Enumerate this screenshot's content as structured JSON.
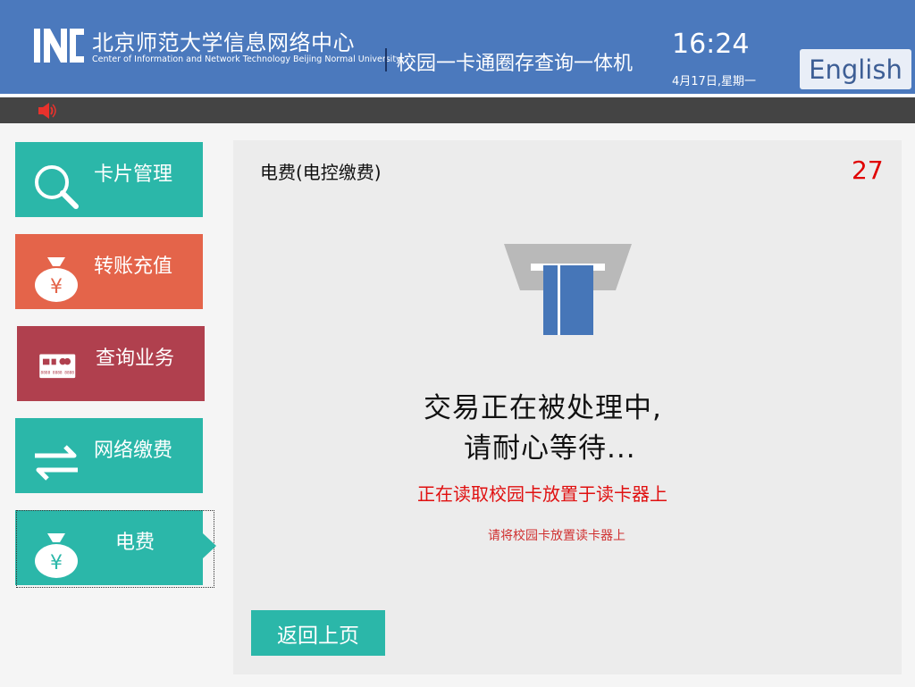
{
  "header": {
    "logo_text": "INC",
    "org_name_cn": "北京师范大学信息网络中心",
    "org_name_en": "Center of Information and Network Technology Beijing Normal University",
    "app_title": "校园一卡通圈存查询一体机",
    "time": "16:24",
    "date": "4月17日,星期一",
    "language_button": "English"
  },
  "sidebar": {
    "items": [
      {
        "label": "卡片管理",
        "icon": "search-icon",
        "color": "#2bb7a9"
      },
      {
        "label": "转账充值",
        "icon": "money-bag-icon",
        "color": "#e4644a"
      },
      {
        "label": "查询业务",
        "icon": "bank-card-icon",
        "color": "#b0404e",
        "card_number": "8888 8888 8888"
      },
      {
        "label": "网络缴费",
        "icon": "transfer-arrows-icon",
        "color": "#2bb7a9"
      },
      {
        "label": "电费",
        "icon": "money-bag-icon",
        "color": "#2bb7a9",
        "selected": true
      }
    ]
  },
  "panel": {
    "title": "电费(电控缴费)",
    "countdown": "27",
    "message_line1": "交易正在被处理中,",
    "message_line2": "请耐心等待...",
    "status_red": "正在读取校园卡放置于读卡器上",
    "hint_red": "请将校园卡放置读卡器上",
    "back_button": "返回上页"
  },
  "colors": {
    "header_bg": "#4b79bd",
    "teal": "#2bb7a9",
    "orange": "#e4644a",
    "crimson": "#b0404e",
    "countdown_red": "#e00000"
  }
}
